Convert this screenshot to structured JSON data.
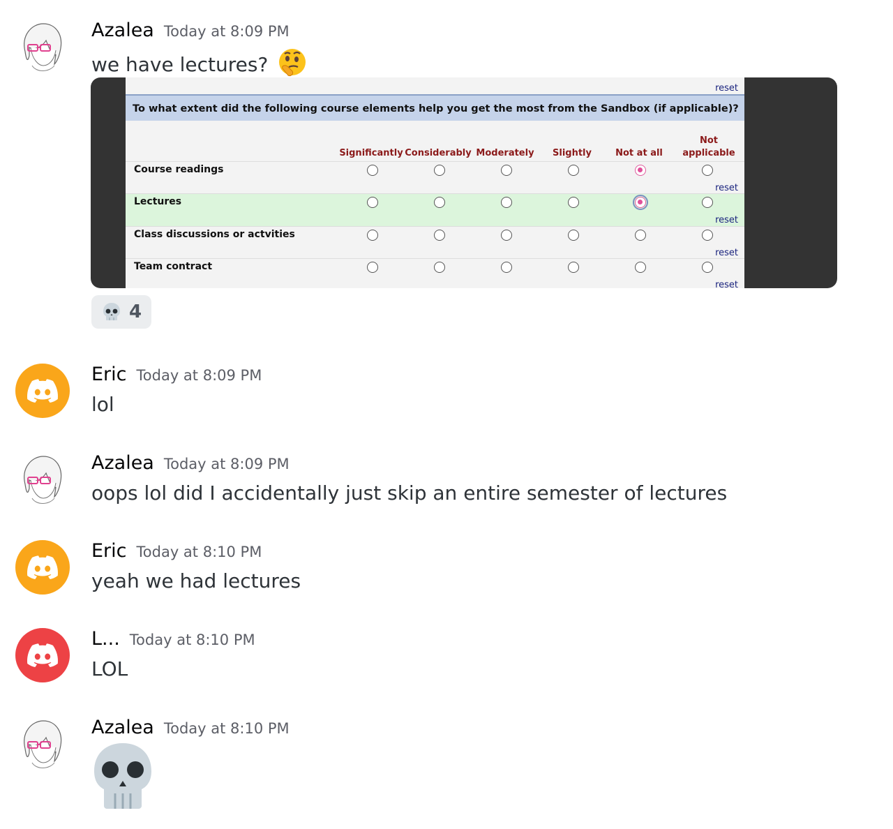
{
  "colors": {
    "discord_orange": "#faa61a",
    "discord_red": "#ed4245",
    "username": "#060607",
    "timestamp": "#5c5e66"
  },
  "messages": [
    {
      "author": "Azalea",
      "timestamp": "Today at 8:09 PM",
      "text": "we have lectures?",
      "emoji": "thinking-face",
      "avatar": "anime-girl-avatar"
    },
    {
      "author": "Eric",
      "timestamp": "Today at 8:09 PM",
      "text": "lol",
      "avatar": "discord-logo-orange"
    },
    {
      "author": "Azalea",
      "timestamp": "Today at 8:09 PM",
      "text": "oops lol did I accidentally just skip an entire semester of lectures",
      "avatar": "anime-girl-avatar"
    },
    {
      "author": "Eric",
      "timestamp": "Today at 8:10 PM",
      "text": "yeah we had lectures",
      "avatar": "discord-logo-orange"
    },
    {
      "author": "L...",
      "timestamp": "Today at 8:10 PM",
      "text": "LOL",
      "avatar": "discord-logo-red"
    },
    {
      "author": "Azalea",
      "timestamp": "Today at 8:10 PM",
      "text": "",
      "emoji": "skull",
      "avatar": "anime-girl-avatar"
    }
  ],
  "reaction": {
    "emoji": "skull",
    "count": "4"
  },
  "survey": {
    "reset_label": "reset",
    "question": "To what extent did the following course elements help you get the most from the Sandbox (if applicable)?",
    "columns": [
      "Significantly",
      "Considerably",
      "Moderately",
      "Slightly",
      "Not at all",
      "Not applicable"
    ],
    "col_not": "Not",
    "col_applicable": "applicable",
    "rows": [
      {
        "label": "Course readings",
        "selected": "Not at all"
      },
      {
        "label": "Lectures",
        "selected": "Not at all"
      },
      {
        "label": "Class discussions or actvities",
        "selected": ""
      },
      {
        "label": "Team contract",
        "selected": ""
      }
    ]
  }
}
